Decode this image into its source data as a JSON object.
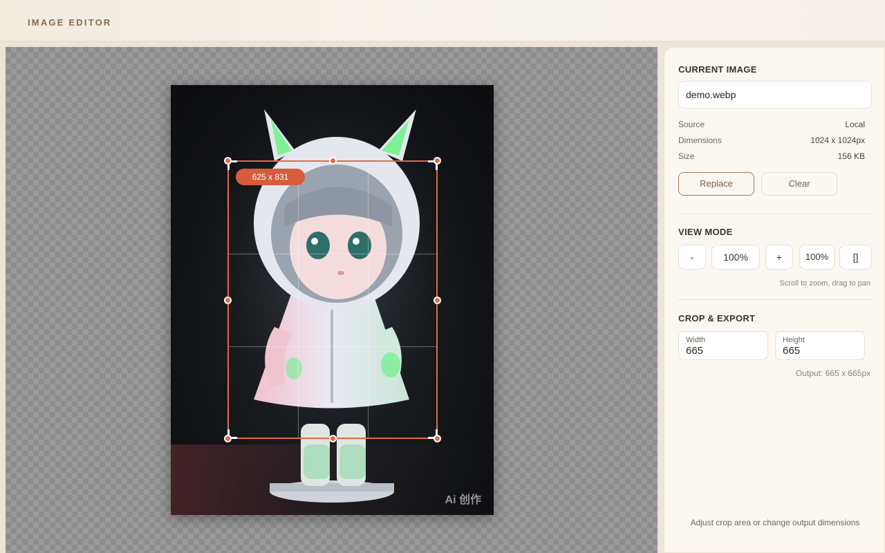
{
  "header": {
    "title": "IMAGE EDITOR"
  },
  "canvas": {
    "crop_label": "625 x 831",
    "watermark": "Ai 创作"
  },
  "panel": {
    "current_image": {
      "title": "CURRENT IMAGE",
      "file_name": "demo.webp",
      "source_label": "Source",
      "source_value": "Local",
      "dimensions_label": "Dimensions",
      "dimensions_value": "1024 x 1024px",
      "size_label": "Size",
      "size_value": "156 KB",
      "replace_label": "Replace",
      "clear_label": "Clear"
    },
    "view_mode": {
      "title": "VIEW MODE",
      "zoom_out_label": "-",
      "zoom_value": "100%",
      "zoom_in_label": "+",
      "fit_value": "100%",
      "fit_icon": "[]",
      "hint": "Scroll to zoom, drag to pan"
    },
    "crop_export": {
      "title": "CROP & EXPORT",
      "width_label": "Width",
      "width_value": "665",
      "height_label": "Height",
      "height_value": "665",
      "output_text": "Output: 665 x 665px"
    },
    "footer_hint": "Adjust crop area or change output dimensions"
  },
  "colors": {
    "accent": "#e26a46",
    "brand_text": "#8a6a47"
  }
}
